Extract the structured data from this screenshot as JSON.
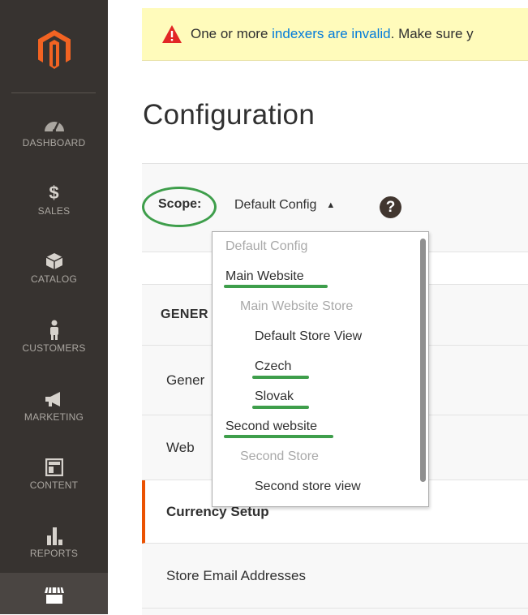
{
  "sidebar": {
    "logo_icon": "magento-logo-icon",
    "items": [
      {
        "label": "DASHBOARD",
        "icon": "speedometer-icon"
      },
      {
        "label": "SALES",
        "icon": "dollar-icon"
      },
      {
        "label": "CATALOG",
        "icon": "box-icon"
      },
      {
        "label": "CUSTOMERS",
        "icon": "person-icon"
      },
      {
        "label": "MARKETING",
        "icon": "megaphone-icon"
      },
      {
        "label": "CONTENT",
        "icon": "layout-icon"
      },
      {
        "label": "REPORTS",
        "icon": "bar-chart-icon"
      },
      {
        "label": "",
        "icon": "store-icon"
      }
    ]
  },
  "notice": {
    "prefix": "One or more ",
    "link": "indexers are invalid",
    "suffix": ". Make sure y",
    "icon": "warning-icon"
  },
  "page": {
    "title": "Configuration"
  },
  "scope": {
    "label": "Scope:",
    "value": "Default Config",
    "help": "?"
  },
  "scope_dropdown": {
    "items": [
      {
        "label": "Default Config",
        "disabled": true
      },
      {
        "label": "Main Website",
        "disabled": false
      },
      {
        "label": "Main Website Store",
        "disabled": true
      },
      {
        "label": "Default Store View",
        "disabled": false
      },
      {
        "label": "Czech",
        "disabled": false
      },
      {
        "label": "Slovak",
        "disabled": false
      },
      {
        "label": "Second website",
        "disabled": false
      },
      {
        "label": "Second Store",
        "disabled": true
      },
      {
        "label": "Second store view",
        "disabled": false
      }
    ]
  },
  "config_tabs": {
    "group": "GENER",
    "items": [
      "Gener",
      "Web",
      "Currency Setup",
      "Store Email Addresses"
    ]
  },
  "colors": {
    "sidebar_bg": "#373330",
    "accent_orange": "#eb5202",
    "highlight_green": "#3e9e4b",
    "link_blue": "#007bdb",
    "notice_bg": "#fffbbb"
  }
}
